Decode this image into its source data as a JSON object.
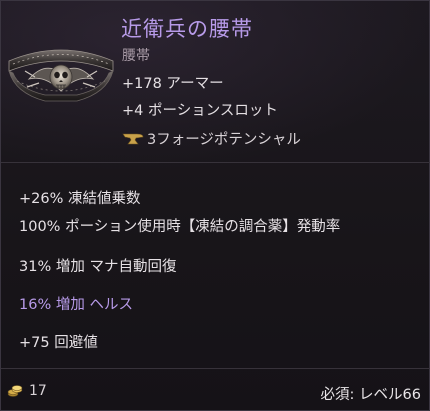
{
  "item": {
    "name": "近衛兵の腰帯",
    "type": "腰帯",
    "base_stats": [
      "+178 アーマー",
      "+4 ポーションスロット"
    ],
    "forge_potential": "3フォージポテンシャル",
    "forge_icon": "anvil-icon",
    "affixes": [
      "+26% 凍結値乗数",
      "100% ポーション使用時【凍結の調合薬】発動率",
      "31% 増加 マナ自動回復",
      "16% 増加 ヘルス",
      "+75 回避値"
    ]
  },
  "footer": {
    "coin_icon": "gold-coin-icon",
    "price": "17",
    "requirement_label": "必須: レベル",
    "requirement_value": "66"
  },
  "colors": {
    "name": "#b79ae8",
    "highlighted_affix": "#b79ae8",
    "background": "#151217"
  }
}
